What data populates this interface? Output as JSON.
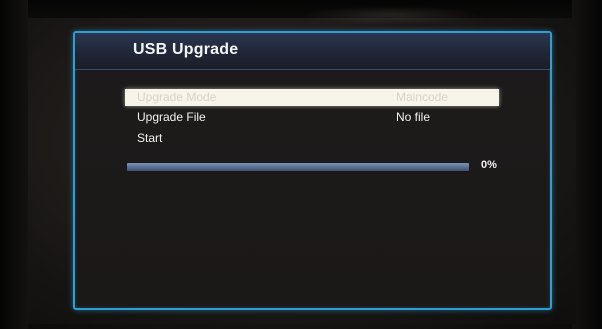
{
  "window": {
    "title": "USB Upgrade"
  },
  "menu": {
    "items": [
      {
        "label": "Upgrade Mode",
        "value": "Maincode",
        "selected": true
      },
      {
        "label": "Upgrade File",
        "value": "No file",
        "selected": false
      },
      {
        "label": "Start",
        "value": "",
        "selected": false
      }
    ]
  },
  "progress": {
    "percent": 0,
    "label": "0%"
  },
  "colors": {
    "frame_accent": "#2f9fd3",
    "selection_bg": "#f7f4ea",
    "text": "#f2f2f2"
  }
}
